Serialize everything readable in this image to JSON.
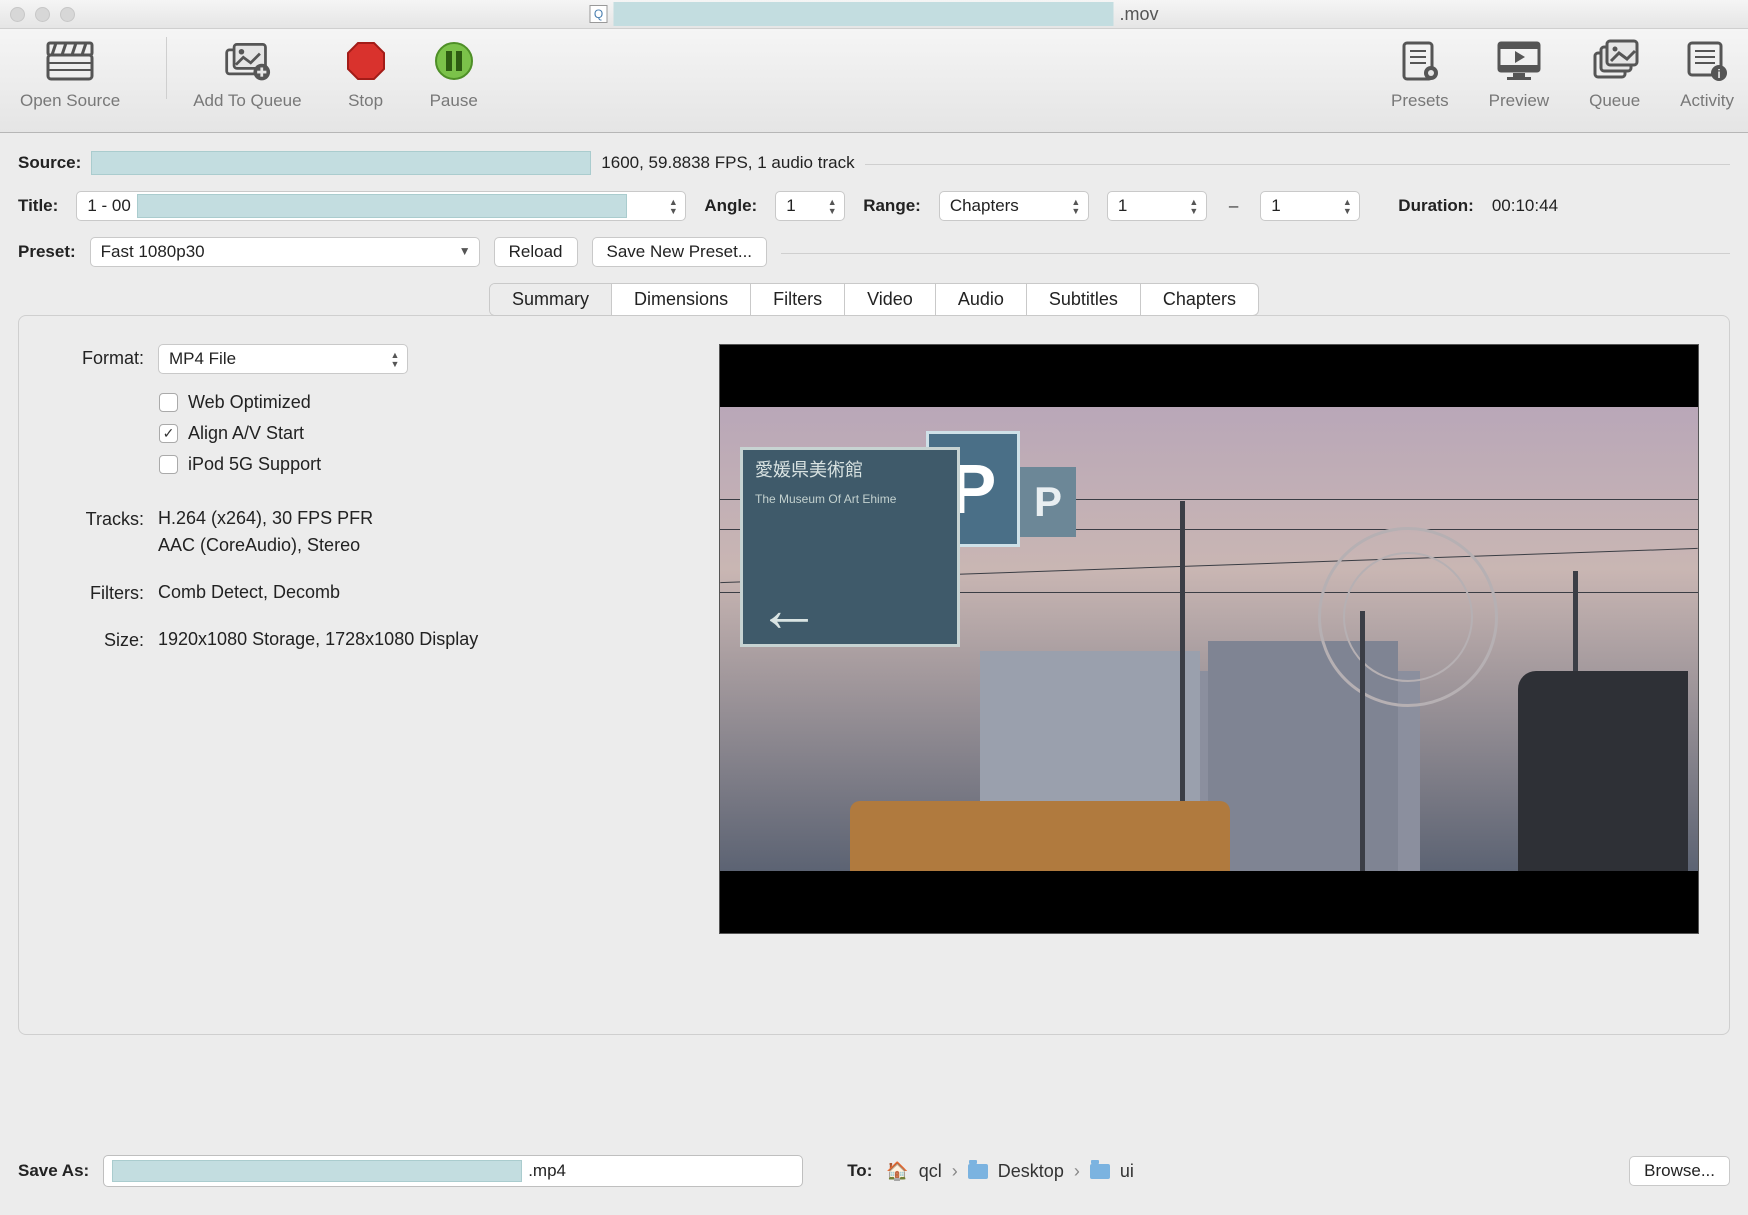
{
  "window": {
    "filename_suffix": ".mov"
  },
  "toolbar": {
    "open_source": "Open Source",
    "add_to_queue": "Add To Queue",
    "stop": "Stop",
    "pause": "Pause",
    "presets": "Presets",
    "preview": "Preview",
    "queue": "Queue",
    "activity": "Activity"
  },
  "source": {
    "label": "Source:",
    "info_suffix": "1600, 59.8838 FPS, 1 audio track"
  },
  "title": {
    "label": "Title:",
    "value_prefix": "1 - 00"
  },
  "angle": {
    "label": "Angle:",
    "value": "1"
  },
  "range": {
    "label": "Range:",
    "mode": "Chapters",
    "from": "1",
    "to": "1"
  },
  "duration": {
    "label": "Duration:",
    "value": "00:10:44"
  },
  "preset": {
    "label": "Preset:",
    "value": "Fast 1080p30",
    "reload": "Reload",
    "save_new": "Save New Preset..."
  },
  "tabs": [
    "Summary",
    "Dimensions",
    "Filters",
    "Video",
    "Audio",
    "Subtitles",
    "Chapters"
  ],
  "active_tab": "Summary",
  "summary": {
    "format_label": "Format:",
    "format_value": "MP4 File",
    "web_optimized": {
      "label": "Web Optimized",
      "checked": false
    },
    "align_av": {
      "label": "Align A/V Start",
      "checked": true
    },
    "ipod5g": {
      "label": "iPod 5G Support",
      "checked": false
    },
    "tracks_label": "Tracks:",
    "tracks_line1": "H.264 (x264), 30 FPS PFR",
    "tracks_line2": "AAC (CoreAudio), Stereo",
    "filters_label": "Filters:",
    "filters_value": "Comb Detect, Decomb",
    "size_label": "Size:",
    "size_value": "1920x1080 Storage, 1728x1080 Display"
  },
  "preview_scene": {
    "sign_text": "愛媛県美術館",
    "sign_sub": "The Museum Of Art Ehime",
    "p": "P"
  },
  "saveas": {
    "label": "Save As:",
    "suffix": ".mp4",
    "to_label": "To:",
    "path": [
      "qcl",
      "Desktop",
      "ui"
    ],
    "browse": "Browse..."
  }
}
